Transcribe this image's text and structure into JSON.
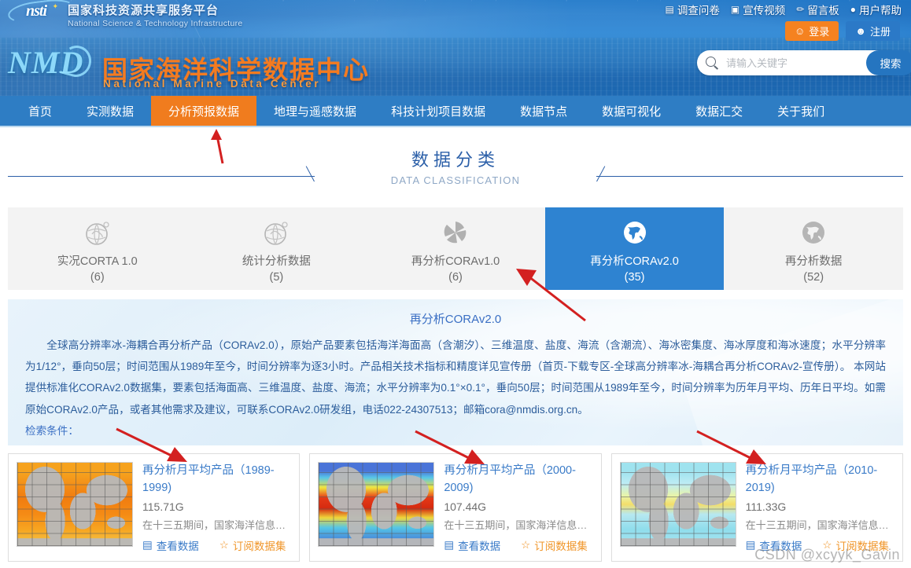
{
  "brand": {
    "nsti_logo_text": "nsti",
    "nsti_cn": "国家科技资源共享服务平台",
    "nsti_en": "National Science & Technology Infrastructure",
    "nmdc_logo_text": "NMD",
    "nmdc_cn": "国家海洋科学数据中心",
    "nmdc_en": "National Marine Data Center"
  },
  "top_links": [
    {
      "label": "调查问卷",
      "icon": "survey-icon"
    },
    {
      "label": "宣传视频",
      "icon": "video-icon"
    },
    {
      "label": "留言板",
      "icon": "message-board-icon"
    },
    {
      "label": "用户帮助",
      "icon": "help-icon"
    }
  ],
  "auth": {
    "login_label": "登录",
    "login_icon": "user-icon",
    "login_color": "#f58220",
    "register_label": "注册",
    "register_icon": "user-add-icon",
    "register_color": "#2b79c7"
  },
  "search": {
    "placeholder": "请输入关键字",
    "value": "",
    "button_label": "搜索",
    "icon": "search-icon"
  },
  "nav": {
    "active_index": 2,
    "items": [
      {
        "label": "首页"
      },
      {
        "label": "实测数据"
      },
      {
        "label": "分析预报数据"
      },
      {
        "label": "地理与遥感数据"
      },
      {
        "label": "科技计划项目数据"
      },
      {
        "label": "数据节点"
      },
      {
        "label": "数据可视化"
      },
      {
        "label": "数据汇交"
      },
      {
        "label": "关于我们"
      }
    ],
    "active_color": "#f07c1e",
    "bar_color": "#2e7dc4"
  },
  "section": {
    "title_cn": "数据分类",
    "title_en": "DATA CLASSIFICATION"
  },
  "categories": {
    "active_index": 3,
    "active_color": "#2e83d1",
    "items": [
      {
        "name": "实况CORTA 1.0",
        "count": "(6)",
        "icon": "globe-outline-icon"
      },
      {
        "name": "统计分析数据",
        "count": "(5)",
        "icon": "globe-outline-icon"
      },
      {
        "name": "再分析CORAv1.0",
        "count": "(6)",
        "icon": "pinwheel-icon"
      },
      {
        "name": "再分析CORAv2.0",
        "count": "(35)",
        "icon": "globe-filled-icon"
      },
      {
        "name": "再分析数据",
        "count": "(52)",
        "icon": "globe-gray-icon"
      }
    ]
  },
  "description": {
    "title": "再分析CORAv2.0",
    "body": "全球高分辨率冰-海耦合再分析产品（CORAv2.0），原始产品要素包括海洋海面高（含潮汐）、三维温度、盐度、海流（含潮流）、海冰密集度、海冰厚度和海冰速度；水平分辨率为1/12°，垂向50层；时间范围从1989年至今，时间分辨率为逐3小时。产品相关技术指标和精度详见宣传册（首页-下载专区-全球高分辨率冰-海耦合再分析CORAv2-宣传册）。 本网站提供标准化CORAv2.0数据集，要素包括海面高、三维温度、盐度、海流；水平分辨率为0.1°×0.1°，垂向50层；时间范围从1989年至今，时间分辨率为历年月平均、历年日平均。如需原始CORAv2.0产品，或者其他需求及建议，可联系CORAv2.0研发组，电话022-24307513；邮箱cora@nmdis.org.cn。",
    "condition_label": "检索条件："
  },
  "results": {
    "view_label": "查看数据",
    "view_icon": "document-search-icon",
    "subscribe_label": "订阅数据集",
    "subscribe_icon": "star-icon",
    "items": [
      {
        "title": "再分析月平均产品（1989-1999)",
        "size": "115.71G",
        "desc": "在十三五期间，国家海洋信息中心...",
        "thumb": "sst-map-orange"
      },
      {
        "title": "再分析月平均产品（2000-2009)",
        "size": "107.44G",
        "desc": "在十三五期间，国家海洋信息中心...",
        "thumb": "sst-map-rainbow"
      },
      {
        "title": "再分析月平均产品（2010-2019)",
        "size": "111.33G",
        "desc": "在十三五期间，国家海洋信息中心...",
        "thumb": "sst-map-cyan"
      }
    ]
  },
  "watermark": "CSDN @xcyyk_Gavin",
  "annotations": {
    "arrow_color": "#d32020",
    "arrows": [
      {
        "name": "arrow-to-nav-active"
      },
      {
        "name": "arrow-to-category-corav2"
      },
      {
        "name": "arrow-to-result-card-1"
      },
      {
        "name": "arrow-to-result-card-2"
      },
      {
        "name": "arrow-to-result-card-3"
      }
    ]
  }
}
